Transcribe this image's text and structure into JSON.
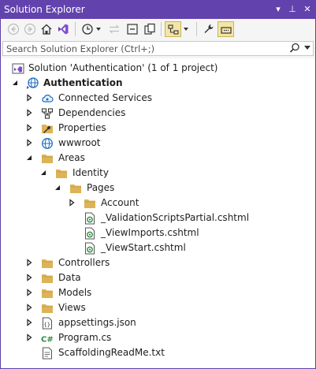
{
  "window": {
    "title": "Solution Explorer",
    "pin_glyph": "▾",
    "pin2_glyph": "⊥",
    "close_glyph": "✕"
  },
  "search": {
    "placeholder": "Search Solution Explorer (Ctrl+;)"
  },
  "colors": {
    "accent": "#6243ad",
    "folder": "#dcb457",
    "selected_bg": "#f3e5a8"
  },
  "tree": {
    "solution": "Solution 'Authentication' (1 of 1 project)",
    "project": "Authentication",
    "connected_services": "Connected Services",
    "dependencies": "Dependencies",
    "properties": "Properties",
    "wwwroot": "wwwroot",
    "areas": "Areas",
    "identity": "Identity",
    "pages": "Pages",
    "account": "Account",
    "validation": "_ValidationScriptsPartial.cshtml",
    "viewimports": "_ViewImports.cshtml",
    "viewstart": "_ViewStart.cshtml",
    "controllers": "Controllers",
    "data": "Data",
    "models": "Models",
    "views": "Views",
    "appsettings": "appsettings.json",
    "program": "Program.cs",
    "readme": "ScaffoldingReadMe.txt"
  }
}
